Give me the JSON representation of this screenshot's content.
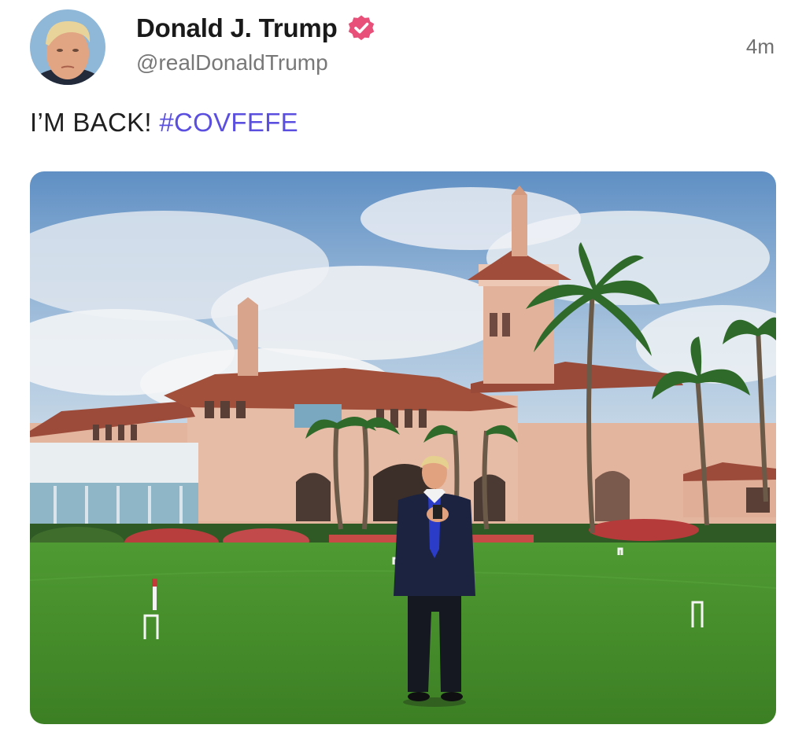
{
  "post": {
    "author": {
      "display_name": "Donald J. Trump",
      "handle": "@realDonaldTrump",
      "verified": true,
      "verified_color": "#e8507a"
    },
    "timestamp": "4m",
    "text": "I’M BACK!",
    "hashtag": "#COVFEFE",
    "hashtag_color": "#5b4fe0",
    "media": {
      "type": "photo"
    }
  }
}
